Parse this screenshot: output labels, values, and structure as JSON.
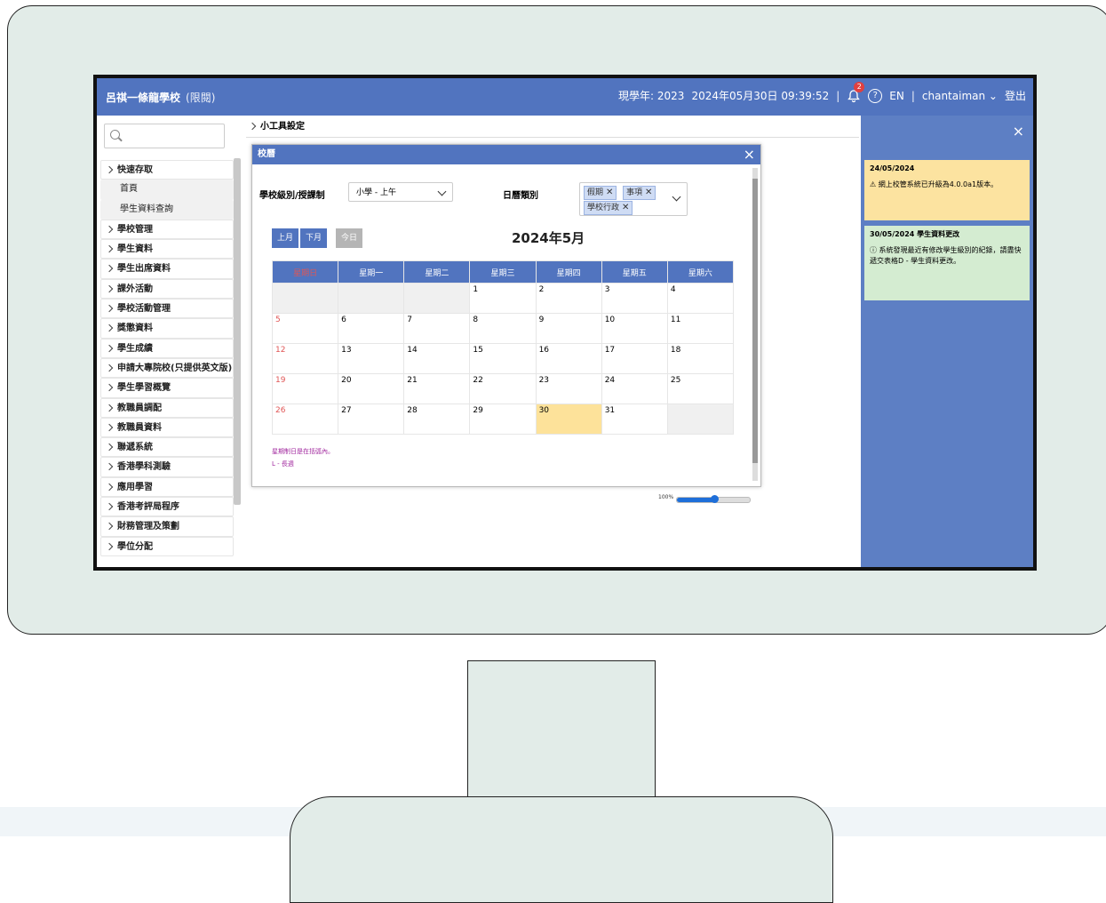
{
  "header": {
    "school": "呂祺一條龍學校",
    "school_sub": "(限閱)",
    "school_year": "現學年: 2023",
    "datetime": "2024年05月30日 09:39:52",
    "notification_count": "2",
    "language": "EN",
    "username": "chantaiman",
    "logout": "登出"
  },
  "sidebar": {
    "search_placeholder": "",
    "items": [
      {
        "label": "快速存取",
        "type": "group"
      },
      {
        "label": "首頁",
        "type": "sub"
      },
      {
        "label": "學生資料查詢",
        "type": "sub"
      },
      {
        "label": "學校管理",
        "type": "group"
      },
      {
        "label": "學生資料",
        "type": "group"
      },
      {
        "label": "學生出席資料",
        "type": "group"
      },
      {
        "label": "課外活動",
        "type": "group"
      },
      {
        "label": "學校活動管理",
        "type": "group"
      },
      {
        "label": "獎懲資料",
        "type": "group"
      },
      {
        "label": "學生成績",
        "type": "group"
      },
      {
        "label": "申請大專院校(只提供英文版)",
        "type": "group"
      },
      {
        "label": "學生學習概覽",
        "type": "group"
      },
      {
        "label": "教職員調配",
        "type": "group"
      },
      {
        "label": "教職員資料",
        "type": "group"
      },
      {
        "label": "聯遞系統",
        "type": "group"
      },
      {
        "label": "香港學科測驗",
        "type": "group"
      },
      {
        "label": "應用學習",
        "type": "group"
      },
      {
        "label": "香港考評局程序",
        "type": "group"
      },
      {
        "label": "財務管理及策劃",
        "type": "group"
      },
      {
        "label": "學位分配",
        "type": "group"
      }
    ]
  },
  "breadcrumb": "小工具設定",
  "modal": {
    "title": "校曆",
    "level_label": "學校級別/授課制",
    "level_value": "小學 - 上午",
    "type_label": "日曆類別",
    "tags": [
      "假期",
      "事項",
      "學校行政"
    ],
    "prev": "上月",
    "next": "下月",
    "today": "今日",
    "month_title": "2024年5月",
    "weekdays": [
      "星期日",
      "星期一",
      "星期二",
      "星期三",
      "星期四",
      "星期五",
      "星期六"
    ],
    "weeks": [
      [
        "",
        "",
        "",
        "1",
        "2",
        "3",
        "4"
      ],
      [
        "5",
        "6",
        "7",
        "8",
        "9",
        "10",
        "11"
      ],
      [
        "12",
        "13",
        "14",
        "15",
        "16",
        "17",
        "18"
      ],
      [
        "19",
        "20",
        "21",
        "22",
        "23",
        "24",
        "25"
      ],
      [
        "26",
        "27",
        "28",
        "29",
        "30",
        "31",
        ""
      ]
    ],
    "today_date": "30",
    "note1": "星期制日是在括弧內。",
    "note2": "L - 長週",
    "zoom": "100%",
    "zoom_level": 0.52
  },
  "notifications": [
    {
      "title": "24/05/2024",
      "body": "網上校管系統已升級為4.0.0a1版本。",
      "kind": "warning"
    },
    {
      "title": "30/05/2024 學生資料更改",
      "body": "系統發現最近有修改學生級別的紀錄，請盡快遞交表格D - 學生資料更改。",
      "kind": "info"
    }
  ],
  "colors": {
    "header_blue": "#5174bf",
    "sunday_red": "#e05656",
    "today_yellow": "#fde29a",
    "warning_bg": "#fce3a0",
    "info_bg": "#d4ecd1",
    "monitor_bg": "#e2ece8"
  }
}
